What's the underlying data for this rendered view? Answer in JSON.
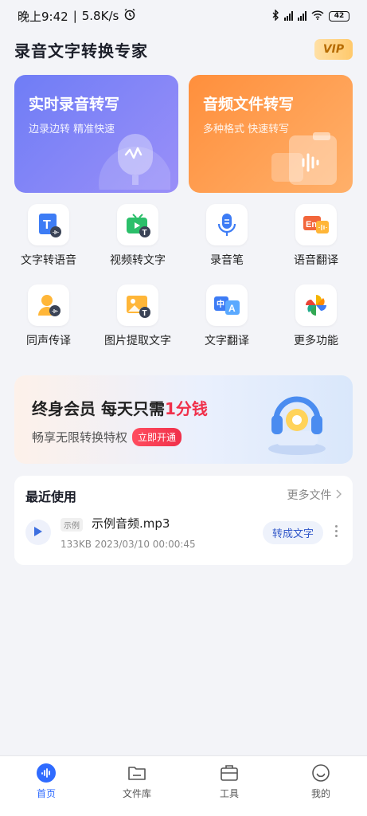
{
  "status_bar": {
    "time": "晚上9:42",
    "speed": "5.8K/s",
    "battery": "42"
  },
  "header": {
    "title": "录音文字转换专家",
    "vip_label": "VIP"
  },
  "cards": {
    "realtime": {
      "title": "实时录音转写",
      "subtitle": "边录边转 精准快速"
    },
    "file": {
      "title": "音频文件转写",
      "subtitle": "多种格式 快速转写"
    }
  },
  "tools": [
    {
      "label": "文字转语音",
      "icon": "text-to-speech-icon"
    },
    {
      "label": "视频转文字",
      "icon": "video-to-text-icon"
    },
    {
      "label": "录音笔",
      "icon": "microphone-icon"
    },
    {
      "label": "语音翻译",
      "icon": "voice-translate-icon"
    },
    {
      "label": "同声传译",
      "icon": "simultaneous-interpretation-icon"
    },
    {
      "label": "图片提取文字",
      "icon": "image-ocr-icon"
    },
    {
      "label": "文字翻译",
      "icon": "text-translate-icon"
    },
    {
      "label": "更多功能",
      "icon": "more-features-icon"
    }
  ],
  "banner": {
    "title_prefix": "终身会员  每天只需",
    "title_highlight": "1分钱",
    "subtitle": "畅享无限转换特权",
    "cta": "立即开通"
  },
  "recent": {
    "title": "最近使用",
    "more_label": "更多文件",
    "items": [
      {
        "tag": "示例",
        "name": "示例音频.mp3",
        "meta": "133KB 2023/03/10 00:00:45",
        "action": "转成文字"
      }
    ]
  },
  "tabbar": {
    "tabs": [
      {
        "label": "首页",
        "active": true
      },
      {
        "label": "文件库",
        "active": false
      },
      {
        "label": "工具",
        "active": false
      },
      {
        "label": "我的",
        "active": false
      }
    ]
  },
  "colors": {
    "accent": "#2f6bff",
    "realtime_card": "#7a84f7",
    "file_card": "#ff9a4a",
    "highlight": "#f0304a"
  }
}
